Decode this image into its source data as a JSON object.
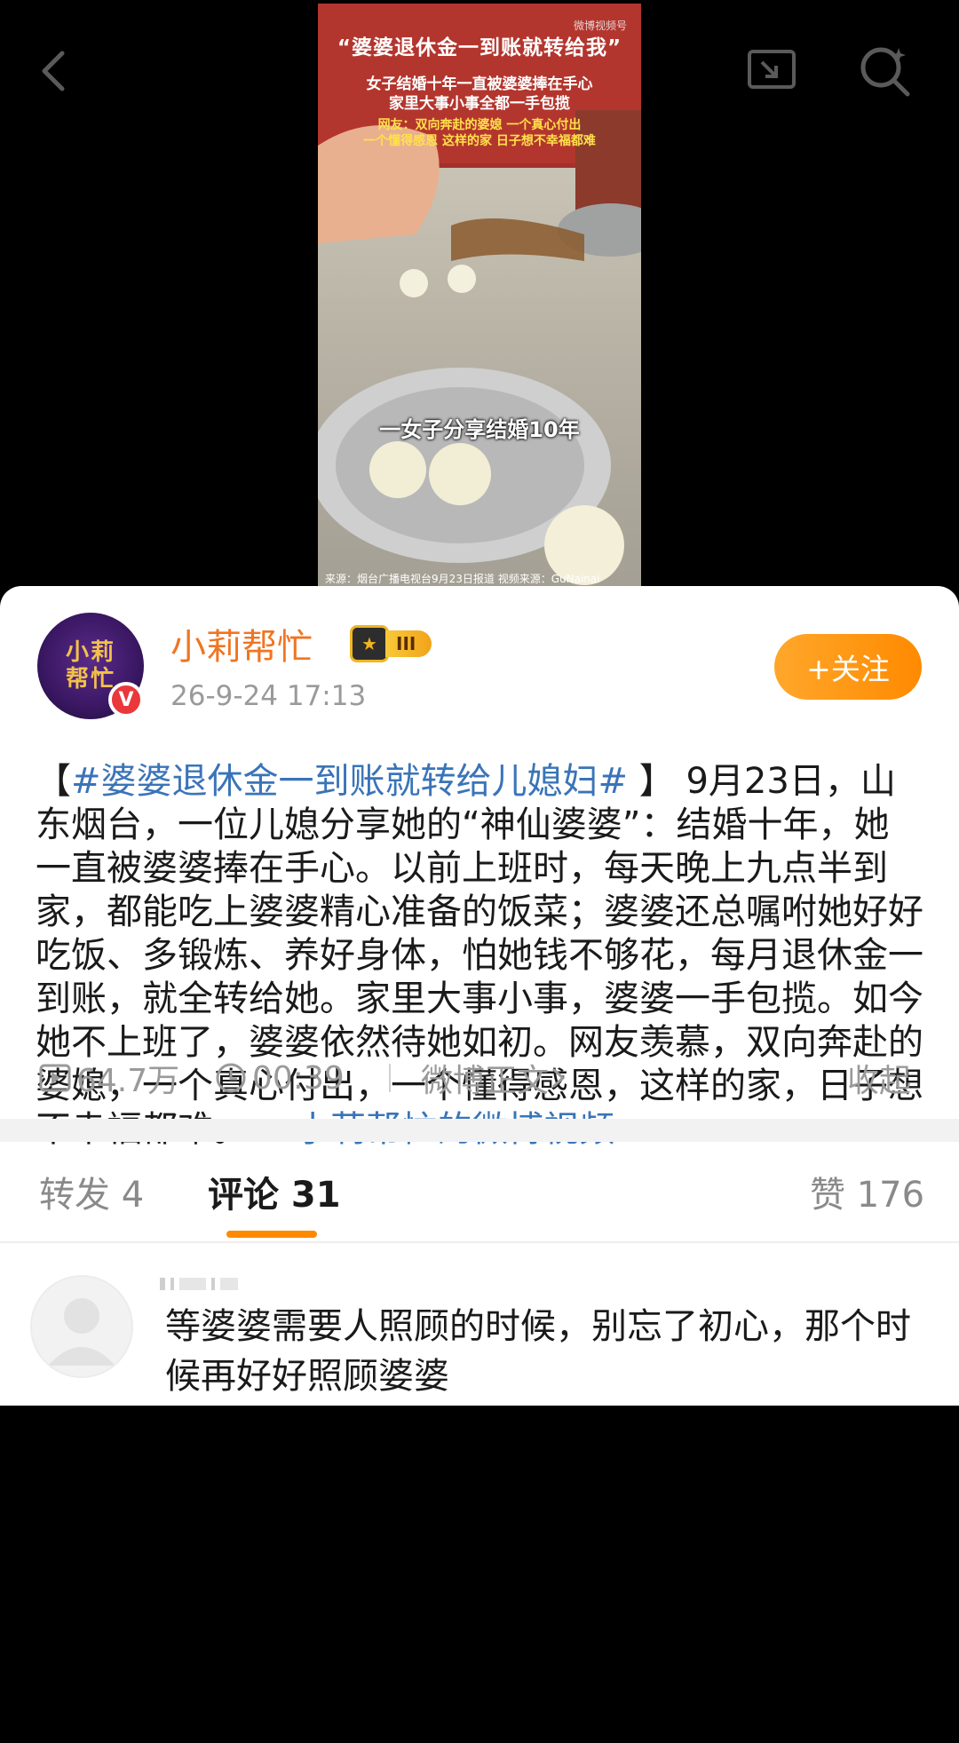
{
  "video": {
    "title_main": "“婆婆退休金一到账就转给我”",
    "title_line2": "女子结婚十年一直被婆婆捧在手心",
    "title_line3": "家里大事小事全都一手包揽",
    "title_line4": "网友：双向奔赴的婆媳 一个真心付出",
    "title_line5": "一个懂得感恩 这样的家 日子想不幸福都难",
    "caption": "一女子分享结婚10年",
    "watermark": "微博视频号",
    "source": "来源：烟台广播电视台9月23日报道 视频来源：GuNainai"
  },
  "post": {
    "avatar_text_1": "小莉",
    "avatar_text_2": "帮忙",
    "verified_mark": "V",
    "username": "小莉帮忙",
    "level": "III",
    "time": "26-9-24 17:13",
    "follow_label": "+关注",
    "hashtag_open": "【",
    "hashtag": "#婆婆退休金一到账就转给儿媳妇#",
    "hashtag_close": " 】 ",
    "body": "9月23日，山东烟台，一位儿媳分享她的“神仙婆婆”：结婚十年，她一直被婆婆捧在手心。以前上班时，每天晚上九点半到家，都能吃上婆婆精心准备的饭菜；婆婆还总嘱咐她好好吃饭、多锻炼、养好身体，怕她钱不够花，每月退休金一到账，就全转给她。家里大事小事，婆婆一手包揽。如今她不上班了，婆婆依然待她如初。网友羡慕，双向奔赴的婆媳，一个真心付出，一个懂得感恩，这样的家，日子想不幸福都难。",
    "video_link": "小莉帮忙的微博视频",
    "views": "64.7万",
    "duration": "00:39",
    "full_text_link": "微博正文",
    "collapse_label": "收起"
  },
  "tabs": {
    "repost": "转发 4",
    "comments": "评论 31",
    "likes": "赞 176"
  },
  "comment": {
    "text": "等婆婆需要人照顾的时候，别忘了初心，那个时候再好好照顾婆婆"
  },
  "colors": {
    "accent": "#ff8a00",
    "link": "#3a74b8",
    "username": "#f07522"
  }
}
